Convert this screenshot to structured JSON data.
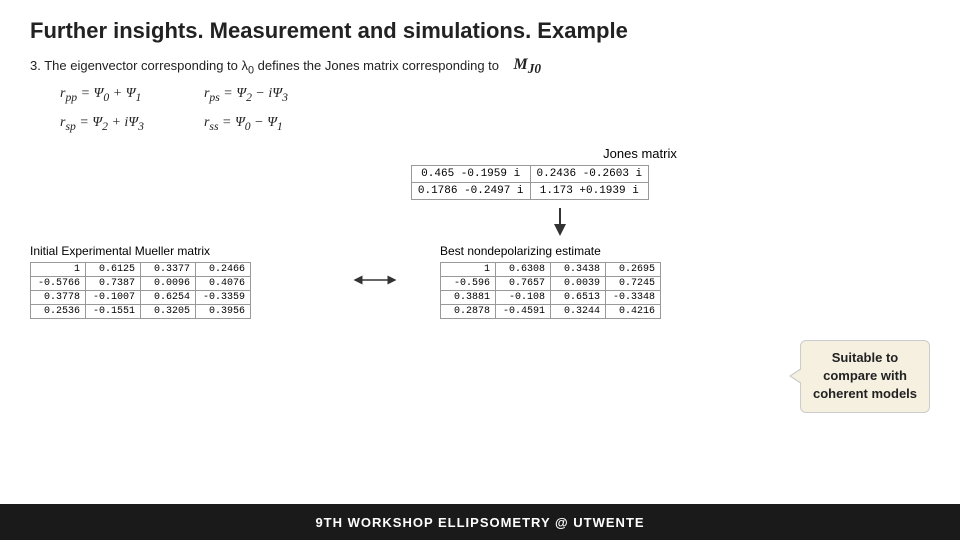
{
  "title": "Further insights. Measurement and simulations. Example",
  "subtitle": "3. The eigenvector corresponding to λ₀ defines the Jones matrix corresponding to",
  "formulas": {
    "left": [
      "r_pp = Ψ₀ + Ψ₁",
      "r_sp = Ψ₂ + iΨ₃"
    ],
    "right": [
      "r_ps = Ψ₂ − iΨ₃",
      "r_ss = Ψ₀ − Ψ₁"
    ]
  },
  "mj0_label": "M_J0",
  "jones_label": "Jones matrix",
  "jones_matrix": {
    "rows": [
      [
        "0.465 -0.1959 i",
        "0.2436 -0.2603 i"
      ],
      [
        "0.1786 -0.2497 i",
        "1.173 +0.1939 i"
      ]
    ]
  },
  "initial_label": "Initial Experimental Mueller matrix",
  "best_label": "Best nondepolarizing estimate",
  "initial_matrix": {
    "rows": [
      [
        "1",
        "0.6125",
        "0.3377",
        "0.2466"
      ],
      [
        "-0.5766",
        "0.7387",
        "0.0096",
        "0.4076"
      ],
      [
        "0.3778",
        "-0.1007",
        "0.6254",
        "-0.3359"
      ],
      [
        "0.2536",
        "-0.1551",
        "0.3205",
        "0.3956"
      ]
    ]
  },
  "best_matrix": {
    "rows": [
      [
        "1",
        "0.6308",
        "0.3438",
        "0.2695"
      ],
      [
        "-0.596",
        "0.7657",
        "0.0039",
        "0.7245"
      ],
      [
        "0.3881",
        "-0.108",
        "0.6513",
        "-0.3348"
      ],
      [
        "0.2878",
        "-0.4591",
        "0.3244",
        "0.4216"
      ]
    ]
  },
  "callout": "Suitable to compare with coherent models",
  "footer": "9TH WORKSHOP ELLIPSOMETRY @ UTWENTE"
}
